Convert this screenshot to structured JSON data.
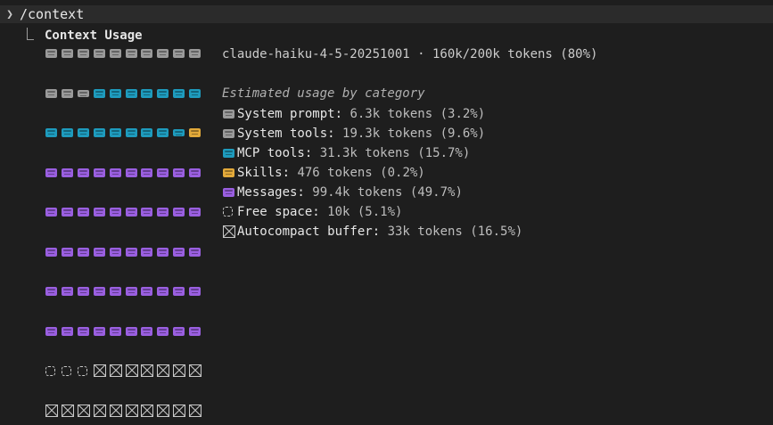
{
  "command": {
    "prompt_icon": "chevron-right-icon",
    "text": "/context"
  },
  "output": {
    "heading": "Context Usage",
    "summary": "claude-haiku-4-5-20251001 · 160k/200k tokens (80%)",
    "categories_title": "Estimated usage by category",
    "categories": [
      {
        "name": "System prompt:",
        "value": "6.3k tokens (3.2%)",
        "icon": "filled-square-icon",
        "color": "#9a9a9a"
      },
      {
        "name": "System tools:",
        "value": "19.3k tokens (9.6%)",
        "icon": "filled-square-icon",
        "color": "#9a9a9a"
      },
      {
        "name": "MCP tools:",
        "value": "31.3k tokens (15.7%)",
        "icon": "filled-square-icon",
        "color": "#1e9bbd"
      },
      {
        "name": "Skills:",
        "value": "476 tokens (0.2%)",
        "icon": "filled-square-icon",
        "color": "#e2a93a"
      },
      {
        "name": "Messages:",
        "value": "99.4k tokens (49.7%)",
        "icon": "filled-square-icon",
        "color": "#9a5fe0"
      },
      {
        "name": "Free space:",
        "value": "10k (5.1%)",
        "icon": "dashed-square-icon",
        "color": "#c8c8c8"
      },
      {
        "name": "Autocompact buffer:",
        "value": "33k tokens (16.5%)",
        "icon": "crossed-square-icon",
        "color": "#c8c8c8"
      }
    ]
  },
  "colors": {
    "system": "#9a9a9a",
    "mcp": "#1e9bbd",
    "skills": "#e2a93a",
    "messages": "#9a5fe0",
    "free": "#c8c8c8",
    "buffer": "#c8c8c8"
  },
  "usage_grid": [
    [
      "system",
      "system",
      "system",
      "system",
      "system",
      "system",
      "system",
      "system",
      "system",
      "system"
    ],
    [
      "system",
      "system",
      "system-half",
      "mcp",
      "mcp",
      "mcp",
      "mcp",
      "mcp",
      "mcp",
      "mcp"
    ],
    [
      "mcp",
      "mcp",
      "mcp",
      "mcp",
      "mcp",
      "mcp",
      "mcp",
      "mcp",
      "mcp-half",
      "skills"
    ],
    [
      "messages",
      "messages",
      "messages",
      "messages",
      "messages",
      "messages",
      "messages",
      "messages",
      "messages",
      "messages"
    ],
    [
      "messages",
      "messages",
      "messages",
      "messages",
      "messages",
      "messages",
      "messages",
      "messages",
      "messages",
      "messages"
    ],
    [
      "messages",
      "messages",
      "messages",
      "messages",
      "messages",
      "messages",
      "messages",
      "messages",
      "messages",
      "messages"
    ],
    [
      "messages",
      "messages",
      "messages",
      "messages",
      "messages",
      "messages",
      "messages",
      "messages",
      "messages",
      "messages"
    ],
    [
      "messages",
      "messages",
      "messages",
      "messages",
      "messages",
      "messages",
      "messages",
      "messages",
      "messages",
      "messages"
    ],
    [
      "free",
      "free",
      "free",
      "buffer",
      "buffer",
      "buffer",
      "buffer",
      "buffer",
      "buffer",
      "buffer"
    ],
    [
      "buffer",
      "buffer",
      "buffer",
      "buffer",
      "buffer",
      "buffer",
      "buffer",
      "buffer",
      "buffer",
      "buffer"
    ]
  ]
}
